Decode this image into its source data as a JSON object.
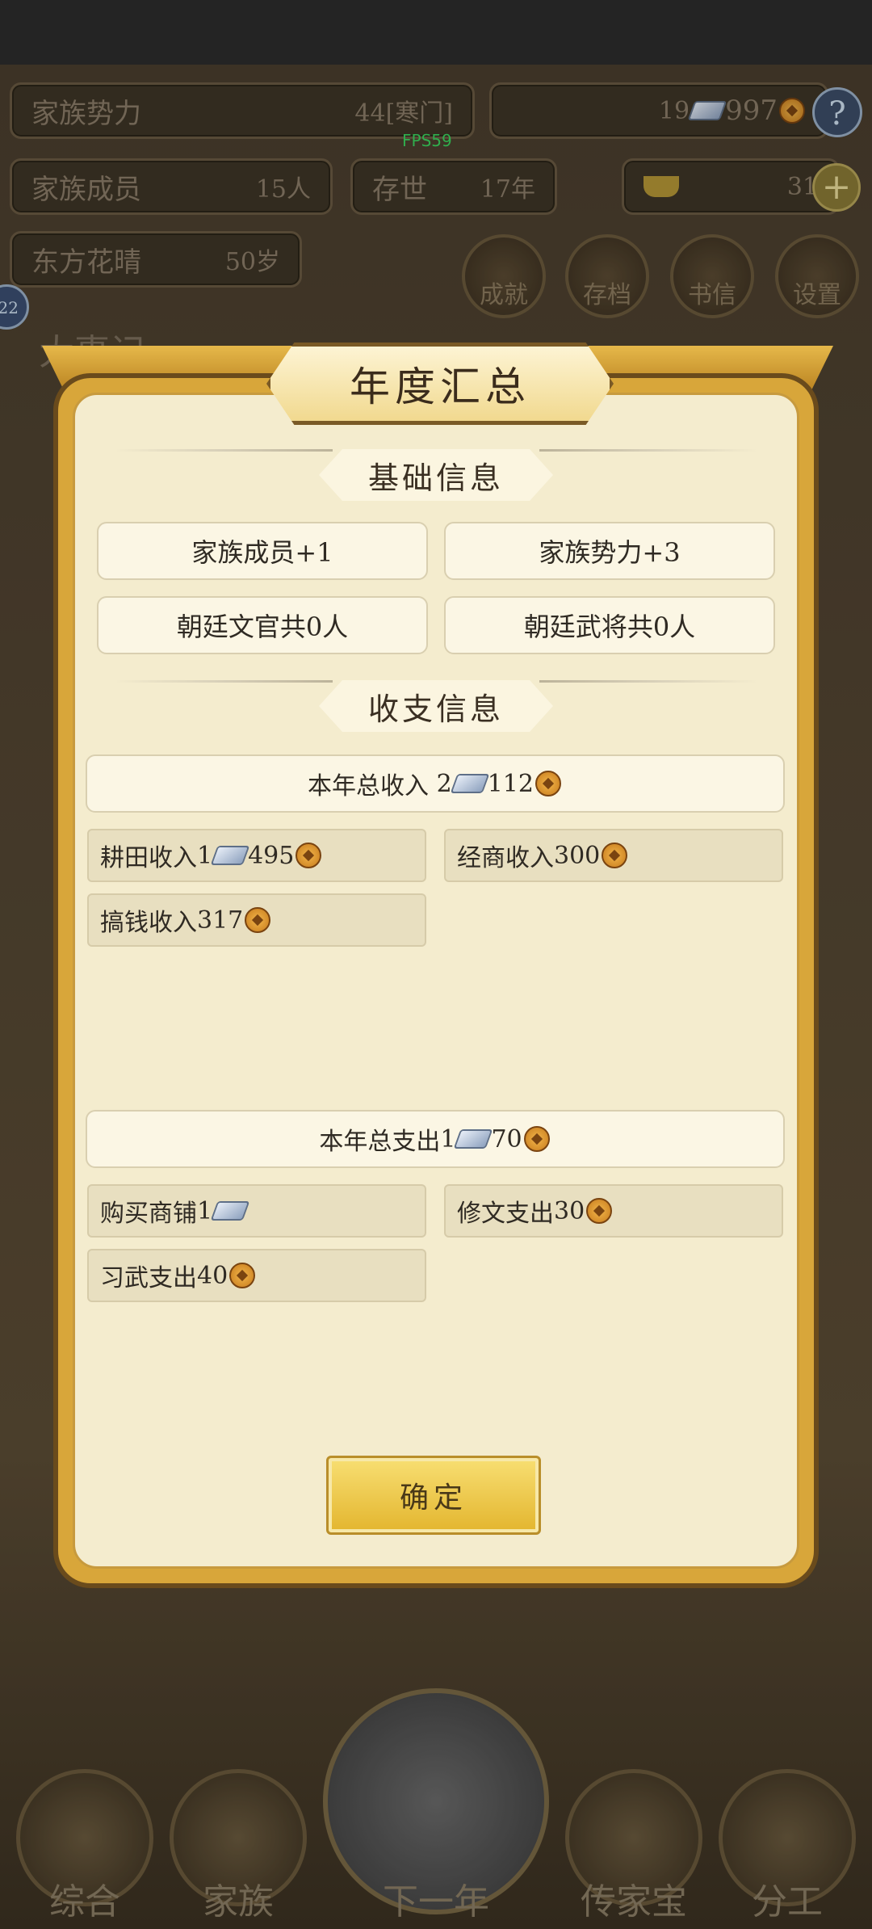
{
  "hud": {
    "family_power": {
      "label": "家族势力",
      "value": "44[寒门]"
    },
    "currency": {
      "silver": "19",
      "coins": "997"
    },
    "help_label": "?",
    "family_members": {
      "label": "家族成员",
      "value": "15人"
    },
    "years": {
      "label": "存世",
      "value": "17年"
    },
    "gold_value": "31",
    "gold_plus": "+",
    "leader": {
      "name": "东方花晴",
      "age": "50岁"
    },
    "fps": "FPS59",
    "round_buttons": [
      "成就",
      "存档",
      "书信",
      "设置"
    ],
    "side_badge": "22",
    "side_title": "大事记"
  },
  "modal": {
    "title": "年度汇总",
    "basic_section": "基础信息",
    "basic_items": [
      "家族成员+1",
      "家族势力+3",
      "朝廷文官共0人",
      "朝廷武将共0人"
    ],
    "finance_section": "收支信息",
    "income_total": {
      "label": "本年总收入",
      "silver": "2",
      "coins": "112"
    },
    "income_items": [
      {
        "label": "耕田收入",
        "silver": "1",
        "coins": "495"
      },
      {
        "label": "经商收入",
        "coins": "300"
      },
      {
        "label": "搞钱收入",
        "coins": "317"
      }
    ],
    "expense_total": {
      "label": "本年总支出",
      "silver": "1",
      "coins": "70"
    },
    "expense_items": [
      {
        "label": "购买商铺",
        "silver": "1"
      },
      {
        "label": "修文支出",
        "coins": "30"
      },
      {
        "label": "习武支出",
        "coins": "40"
      }
    ],
    "confirm_label": "确定"
  },
  "bottom_nav": [
    "综合",
    "家族",
    "下一年",
    "传家宝",
    "分工"
  ]
}
